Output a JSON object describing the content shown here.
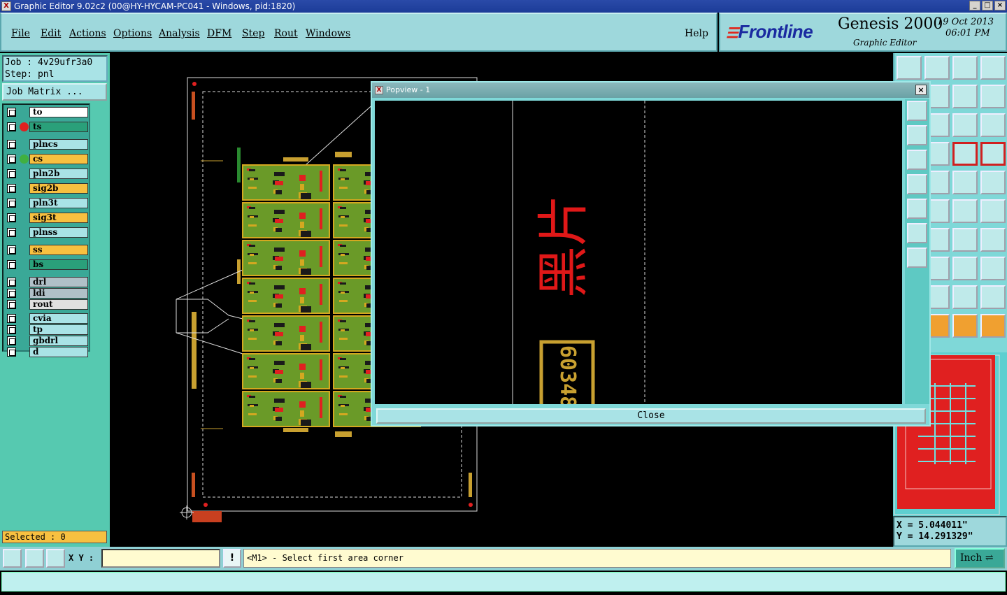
{
  "window": {
    "title": "Graphic Editor 9.02c2 (00@HY-HYCAM-PC041 - Windows, pid:1820)",
    "icon": "app-icon",
    "controls": [
      "minimize",
      "maximize",
      "close"
    ]
  },
  "menubar": {
    "items": [
      "File",
      "Edit",
      "Actions",
      "Options",
      "Analysis",
      "DFM",
      "Step",
      "Rout",
      "Windows"
    ],
    "help": "Help"
  },
  "brand": {
    "logo": "Frontline",
    "product": "Genesis 2000",
    "subtitle": "Graphic Editor",
    "date": "19 Oct 2013",
    "time": "06:01 PM"
  },
  "job": {
    "job_label": "Job : 4v29ufr3a0",
    "step_label": "Step: pnl",
    "matrix_button": "Job Matrix ..."
  },
  "layers": [
    {
      "name": "to",
      "color": "#ffffff"
    },
    {
      "name": "ts",
      "color": "#2aa07a",
      "active": true,
      "dot": "#e02020"
    },
    {
      "name": "plncs",
      "color": "#a9e3e6"
    },
    {
      "name": "cs",
      "color": "#f7c040",
      "dot": "#40b040"
    },
    {
      "name": "pln2b",
      "color": "#a9e3e6"
    },
    {
      "name": "sig2b",
      "color": "#f7c040"
    },
    {
      "name": "pln3t",
      "color": "#a9e3e6"
    },
    {
      "name": "sig3t",
      "color": "#f7c040"
    },
    {
      "name": "plnss",
      "color": "#a9e3e6"
    },
    {
      "name": "ss",
      "color": "#f7c040"
    },
    {
      "name": "bs",
      "color": "#2aa07a"
    },
    {
      "name": "drl",
      "color": "#b0c0c8"
    },
    {
      "name": "ldi",
      "color": "#b0c0c8"
    },
    {
      "name": "rout",
      "color": "#e0e0e0"
    },
    {
      "name": "cvia",
      "color": "#a9e3e6"
    },
    {
      "name": "tp",
      "color": "#a9e3e6"
    },
    {
      "name": "gbdrl",
      "color": "#a9e3e6"
    },
    {
      "name": "d",
      "color": "#a9e3e6"
    }
  ],
  "selected_text": "Selected : 0",
  "popview": {
    "title": "Popview - 1",
    "close_label": "Close",
    "content_glyphs": "黑片",
    "content_code": "60348"
  },
  "coords": {
    "x": "X = 5.044011\"",
    "y": "Y = 14.291329\""
  },
  "bottom": {
    "xy_label": "X Y :",
    "xy_value": "",
    "prompt": "<M1> - Select first area corner",
    "units": "Inch"
  },
  "colors": {
    "panel": "#9ed8dc",
    "board_green": "#6a9a28",
    "board_yellow": "#d4a820",
    "accent_red": "#e02020"
  }
}
